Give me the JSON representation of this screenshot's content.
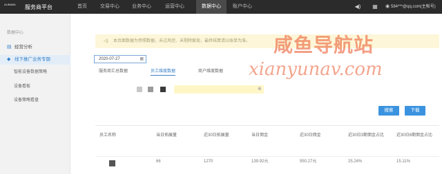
{
  "app": {
    "logo_mark": "ALIBABA",
    "title": "服务商平台"
  },
  "topnav": [
    {
      "label": "首页"
    },
    {
      "label": "交易中心"
    },
    {
      "label": "业务中心"
    },
    {
      "label": "运营中心"
    },
    {
      "label": "数据中心",
      "active": true
    },
    {
      "label": "账户中心"
    }
  ],
  "top_right": {
    "icons": [
      "volume-icon",
      "calendar-icon"
    ],
    "user": "584***@qq.com(主帐号)"
  },
  "sidebar": {
    "heading": "数据中心",
    "items": [
      {
        "label": "经营分析",
        "icon": "chart-icon"
      },
      {
        "label": "线下推广业务专题",
        "icon": "tag-icon",
        "active": true
      }
    ],
    "subitems": [
      {
        "label": "智能设备数据策略"
      },
      {
        "label": "设备看板"
      },
      {
        "label": "设备策略看盘"
      }
    ]
  },
  "notice": {
    "text": "本页面数据为参照数据，未过风控、未剔除套现，最终结算请以账单为准。"
  },
  "date_filter": {
    "value": "2020-07-27"
  },
  "tabs": [
    {
      "label": "服务商汇总数据"
    },
    {
      "label": "员工维度数据",
      "active": true
    },
    {
      "label": "商户维度数据"
    }
  ],
  "buttons": {
    "search": "搜索",
    "download": "下载"
  },
  "table": {
    "columns": [
      "员工名称",
      "当日拓展量",
      "近30日拓展量",
      "当日佣金",
      "近30日佣金",
      "近30日3期佣金占比",
      "近30日6期佣金占比"
    ],
    "rows": [
      {
        "name": "",
        "today_expand": "66",
        "expand_30d": "1270",
        "today_commission": "139.92元",
        "commission_30d": "950.27元",
        "ratio_3": "25.24%",
        "ratio_6": "15.11%"
      }
    ]
  },
  "watermark": {
    "line1": "咸鱼导航站",
    "line2": "xianyunav.com"
  },
  "colors": {
    "topbar": "#2b2b2b",
    "accent": "#3b93e0",
    "notice_bg": "#fdf6d8",
    "watermark": "#eb643c"
  }
}
